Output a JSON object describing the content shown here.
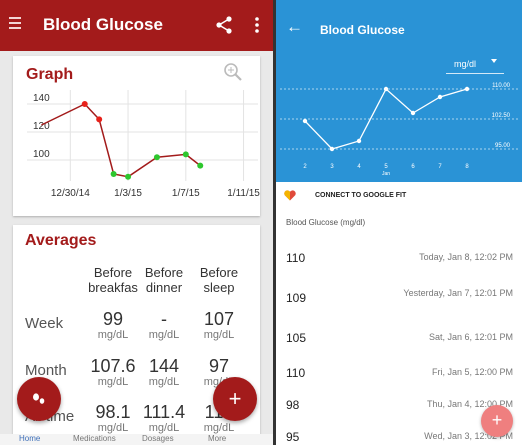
{
  "left": {
    "appbar_title": "Blood Glucose",
    "graph_card": {
      "title": "Graph",
      "chart_data": {
        "type": "line",
        "x_tick_labels": [
          "12/30/14",
          "1/3/15",
          "1/7/15",
          "1/11/15"
        ],
        "y_tick_labels": [
          "140",
          "120",
          "100"
        ],
        "ylim": [
          85,
          150
        ],
        "x": [
          "12/28/14",
          "12/31/14",
          "1/1/15",
          "1/2/15",
          "1/3/15",
          "1/5/15",
          "1/7/15",
          "1/8/15"
        ],
        "values": [
          125,
          140,
          129,
          90,
          88,
          102,
          104,
          96
        ],
        "line_color": "#a31b1b",
        "point_colors": [
          "none",
          "#e8211a",
          "#e8211a",
          "#2ec72e",
          "#2ec72e",
          "#2ec72e",
          "#2ec72e",
          "#2ec72e"
        ],
        "grid": true
      }
    },
    "averages_card": {
      "title": "Averages",
      "columns": [
        "Before breakfas",
        "Before dinner",
        "Before sleep"
      ],
      "rows": [
        {
          "label": "Week",
          "values": [
            "99",
            "-",
            "107"
          ],
          "units": [
            "mg/dL",
            "mg/dL",
            "mg/dL"
          ]
        },
        {
          "label": "Month",
          "values": [
            "107.6",
            "144",
            "97"
          ],
          "units": [
            "mg/dL",
            "mg/dL",
            "mg/dL"
          ]
        },
        {
          "label": "All time",
          "values": [
            "98.1",
            "111.4",
            "110"
          ],
          "units": [
            "mg/dL",
            "mg/dL",
            "mg/dL"
          ]
        }
      ]
    },
    "fab_plus_label": "+",
    "bottom_tabs": [
      "Home",
      "Medications",
      "Dosages",
      "More"
    ]
  },
  "right": {
    "appbar_title": "Blood Glucose",
    "back_icon": "←",
    "unit_selector": "mg/dl",
    "chart_data": {
      "type": "line",
      "categories": [
        "2",
        "3",
        "4",
        "5",
        "6",
        "7",
        "8"
      ],
      "x_axis_sublabel": "Jan",
      "values": [
        102,
        95,
        97,
        110,
        104,
        108,
        110
      ],
      "ref_lines": [
        "110.00",
        "102.50",
        "95.00"
      ],
      "ylim": [
        93,
        112
      ],
      "color": "#2a93d6"
    },
    "fit_label": "CONNECT TO GOOGLE FIT",
    "list_header": "Blood Glucose (mg/dl)",
    "entries": [
      {
        "value": "110",
        "datetime": "Today, Jan 8, 12:02 PM"
      },
      {
        "value": "109",
        "datetime": "Yesterday, Jan 7, 12:01 PM"
      },
      {
        "value": "105",
        "datetime": "Sat, Jan 6, 12:01 PM"
      },
      {
        "value": "110",
        "datetime": "Fri, Jan 5, 12:00 PM"
      },
      {
        "value": "98",
        "datetime": "Thu, Jan 4, 12:00 PM"
      },
      {
        "value": "95",
        "datetime": "Wed, Jan 3, 12:02 PM"
      }
    ],
    "fab_plus_label": "+"
  }
}
